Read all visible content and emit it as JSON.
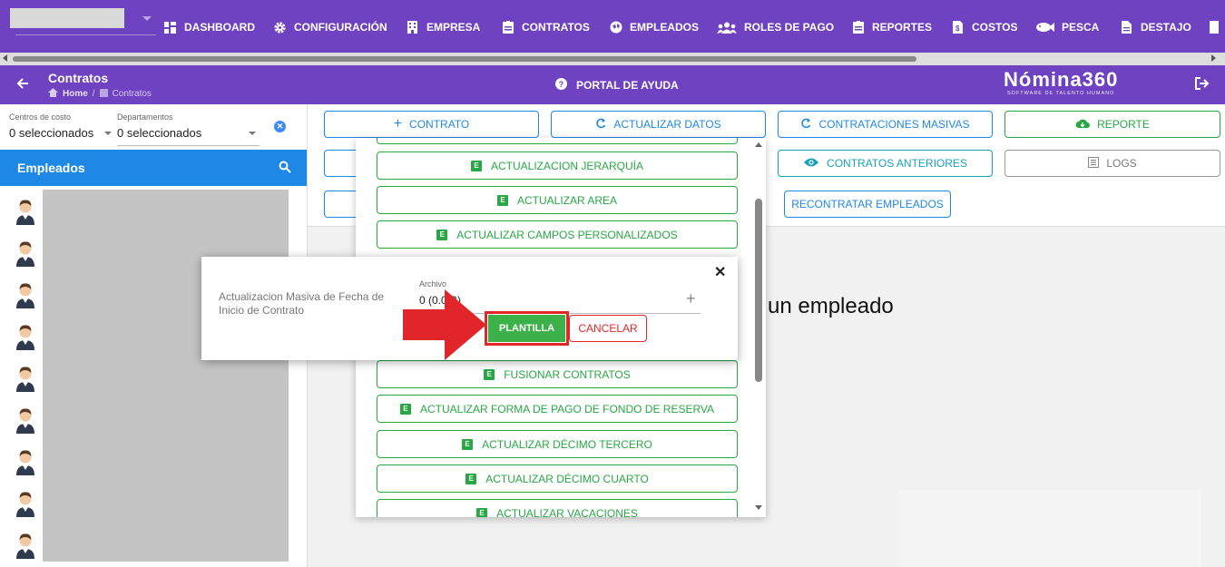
{
  "topnav": {
    "items": [
      {
        "label": "DASHBOARD",
        "icon": "dashboard-icon"
      },
      {
        "label": "CONFIGURACIÓN",
        "icon": "gear-icon"
      },
      {
        "label": "EMPRESA",
        "icon": "building-icon"
      },
      {
        "label": "CONTRATOS",
        "icon": "clipboard-icon"
      },
      {
        "label": "EMPLEADOS",
        "icon": "globe-icon"
      },
      {
        "label": "ROLES DE PAGO",
        "icon": "users-icon"
      },
      {
        "label": "REPORTES",
        "icon": "clipboard-icon"
      },
      {
        "label": "COSTOS",
        "icon": "invoice-icon"
      },
      {
        "label": "PESCA",
        "icon": "fish-icon"
      },
      {
        "label": "DESTAJO",
        "icon": "file-icon"
      }
    ]
  },
  "header": {
    "title": "Contratos",
    "breadcrumb": {
      "home": "Home",
      "current": "Contratos"
    },
    "help": "PORTAL DE AYUDA",
    "logo": {
      "main": "Nómina360",
      "sub": "SOFTWARE DE TALENTO HUMANO"
    }
  },
  "filters": {
    "centros": {
      "label": "Centros de costo",
      "value": "0 seleccionados"
    },
    "departamentos": {
      "label": "Departamentos",
      "value": "0 seleccionados"
    }
  },
  "employees": {
    "title": "Empleados",
    "avatar_count": 9
  },
  "toolbar": {
    "contrato": "CONTRATO",
    "actualizar_datos": "ACTUALIZAR DATOS",
    "contrataciones_masivas": "CONTRATACIONES MASIVAS",
    "reporte": "REPORTE",
    "contratos_anteriores": "CONTRATOS ANTERIORES",
    "logs": "LOGS",
    "recontratar": "RECONTRATAR EMPLEADOS"
  },
  "background_text": "un empleado",
  "dropdown": {
    "items": [
      "ACTUALIZACION JERARQUÍA",
      "ACTUALIZAR AREA",
      "ACTUALIZAR CAMPOS PERSONALIZADOS",
      "FUSIONAR CONTRATOS",
      "ACTUALIZAR FORMA DE PAGO DE FONDO DE RESERVA",
      "ACTUALIZAR DÉCIMO TERCERO",
      "ACTUALIZAR DÉCIMO CUARTO",
      "ACTUALIZAR VACACIONES"
    ],
    "badge": "E"
  },
  "modal": {
    "label": "Actualizacion Masiva de Fecha de Inicio de Contrato",
    "file_label": "Archivo",
    "file_value": "0 (0.0 B)",
    "plantilla": "PLANTILLA",
    "cancelar": "CANCELAR"
  },
  "colors": {
    "primary": "#6f42c1",
    "blue": "#1e88e5",
    "green": "#28a745",
    "red": "#e0262b"
  }
}
